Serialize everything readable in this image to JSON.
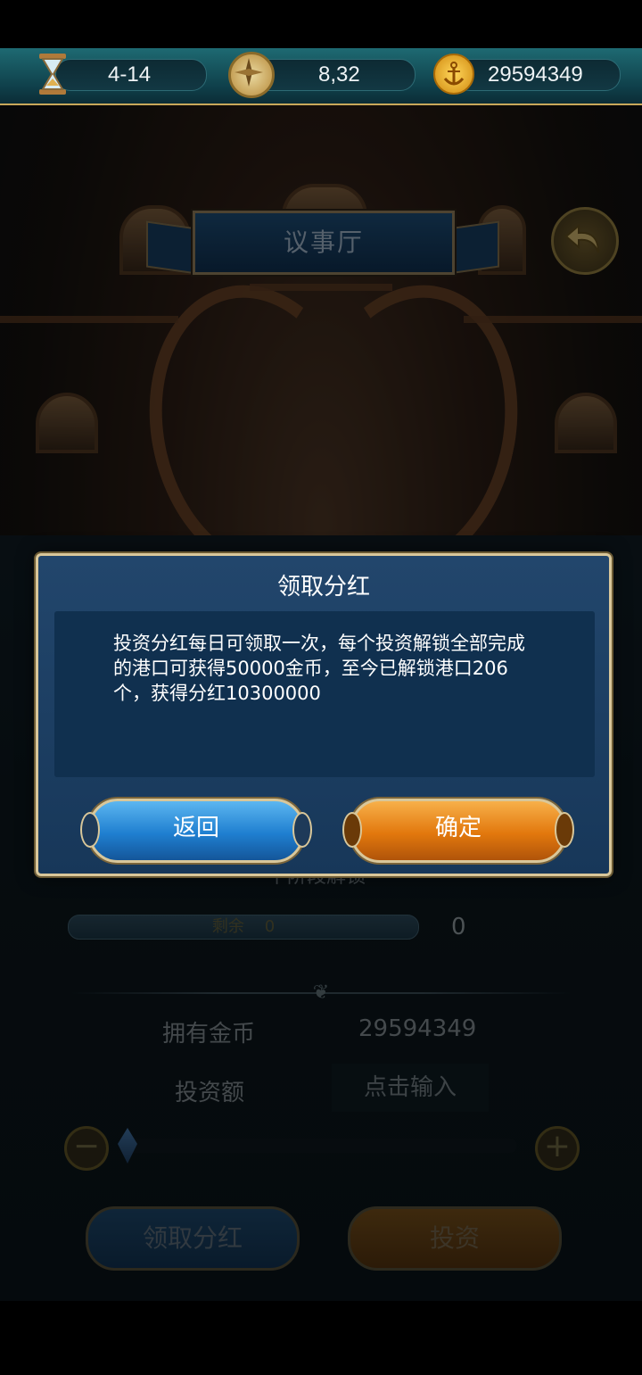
{
  "topbar": {
    "date": "4-14",
    "compass_value": "8,32",
    "gold": "29594349",
    "icons": [
      "hourglass-icon",
      "compass-icon",
      "anchor-coin-icon"
    ]
  },
  "scene": {
    "title": "议事厅",
    "back_icon": "back-arrow-icon"
  },
  "panel": {
    "next_stage_unlock": "下阶段解锁",
    "remaining_label": "剩余",
    "remaining_value": "0",
    "progress_count": "0",
    "own_gold_label": "拥有金币",
    "own_gold_value": "29594349",
    "invest_label": "投资额",
    "invest_placeholder": "点击输入",
    "collect_button": "领取分红",
    "invest_button": "投资"
  },
  "dialog": {
    "title": "领取分红",
    "message": "投资分红每日可领取一次，每个投资解锁全部完成的港口可获得50000金币，至今已解锁港口206个，获得分红10300000",
    "back_button": "返回",
    "confirm_button": "确定"
  },
  "colors": {
    "dialog_bg": "#1c3f63",
    "gold_border": "#d9c79a",
    "blue_button": "#1f7fd0",
    "orange_button": "#e2780d"
  }
}
